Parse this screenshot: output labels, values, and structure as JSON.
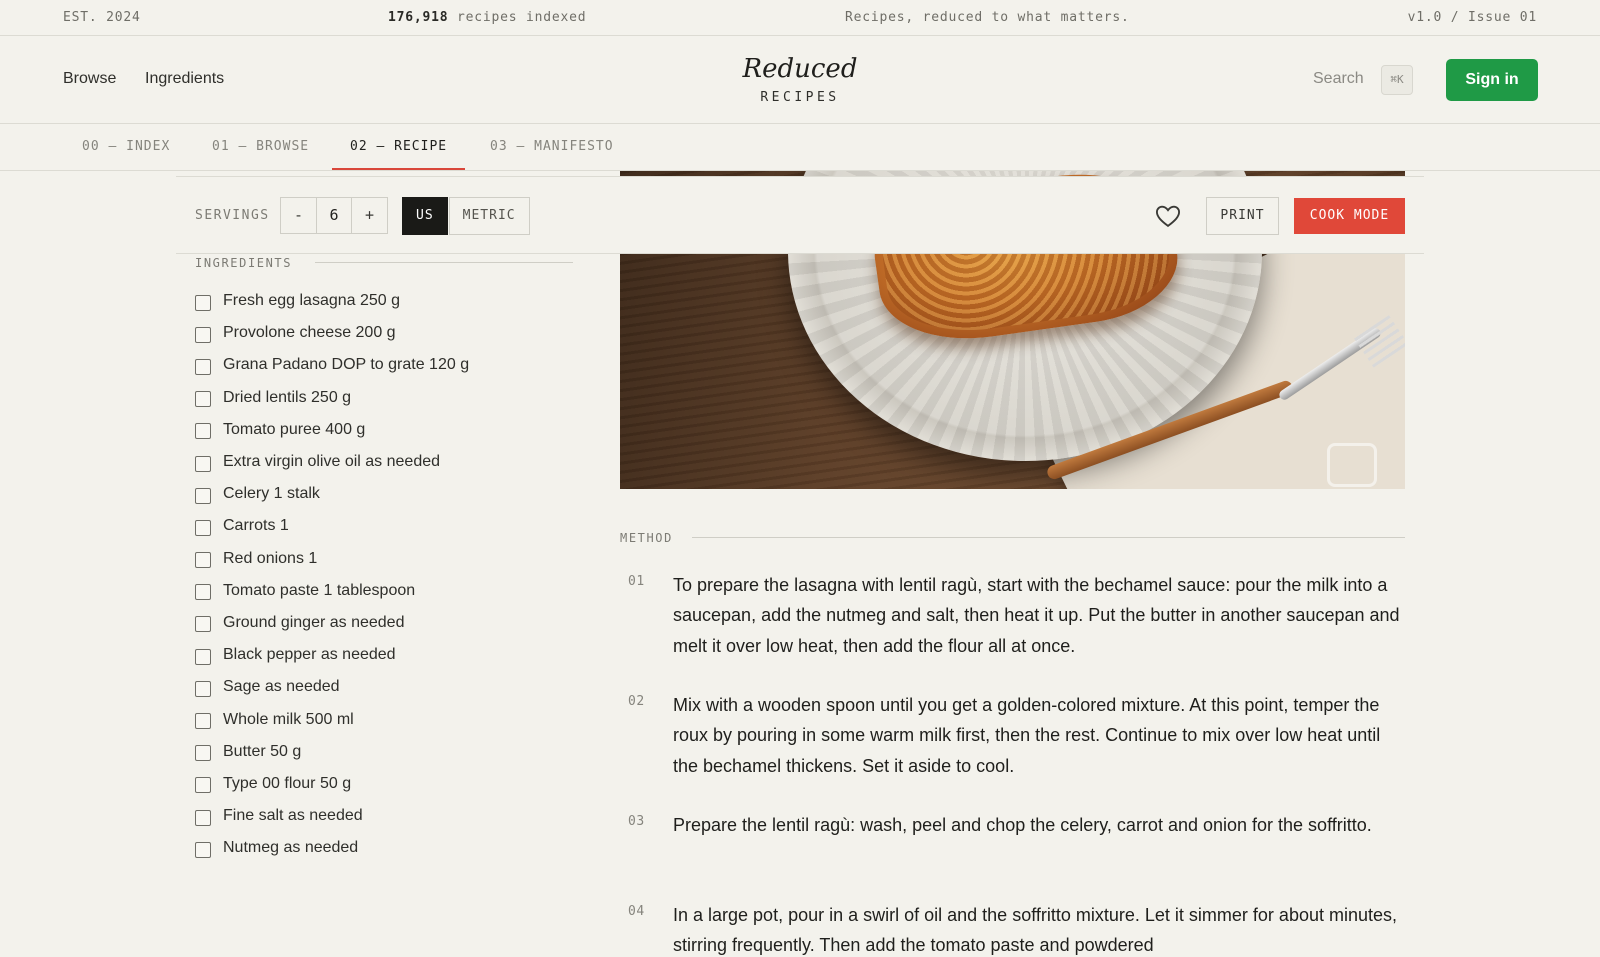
{
  "topbar": {
    "est": "EST. 2024",
    "recipe_count": "176,918",
    "recipe_count_suffix": " recipes indexed",
    "tagline": "Recipes, reduced to what matters.",
    "version": "v1.0 / Issue 01"
  },
  "header": {
    "nav": [
      "Browse",
      "Ingredients"
    ],
    "logo_word": "Reduced",
    "logo_sub": "RECIPES",
    "search_label": "Search",
    "search_shortcut": "⌘K",
    "signin_label": "Sign in"
  },
  "tabs": [
    "00 — INDEX",
    "01 — BROWSE",
    "02 — RECIPE",
    "03 — MANIFESTO"
  ],
  "active_tab": 2,
  "toolbar": {
    "servings_label": "SERVINGS",
    "decrement": "-",
    "servings_value": "6",
    "increment": "+",
    "units": [
      "US",
      "METRIC"
    ],
    "active_unit": "US",
    "print_label": "PRINT",
    "cook_mode_label": "COOK MODE"
  },
  "ingredients": {
    "title": "INGREDIENTS",
    "items": [
      "Fresh egg lasagna 250 g",
      "Provolone cheese 200 g",
      "Grana Padano DOP to grate 120 g",
      "Dried lentils 250 g",
      "Tomato puree 400 g",
      "Extra virgin olive oil as needed",
      "Celery 1 stalk",
      "Carrots 1",
      "Red onions 1",
      "Tomato paste 1 tablespoon",
      "Ground ginger as needed",
      "Black pepper as needed",
      "Sage as needed",
      "Whole milk 500 ml",
      "Butter 50 g",
      "Type 00 flour 50 g",
      "Fine salt as needed",
      "Nutmeg as needed"
    ]
  },
  "method": {
    "title": "METHOD",
    "steps": [
      {
        "num": "01",
        "text": "To prepare the lasagna with lentil ragù, start with the bechamel sauce: pour the milk into a saucepan, add the nutmeg and salt, then heat it up. Put the butter in another saucepan and melt it over low heat, then add the flour all at once."
      },
      {
        "num": "02",
        "text": "Mix with a wooden spoon until you get a golden-colored mixture. At this point, temper the roux by pouring in some warm milk first, then the rest. Continue to mix over low heat until the bechamel thickens. Set it aside to cool."
      },
      {
        "num": "03",
        "text": "Prepare the lentil ragù: wash, peel and chop the celery, carrot and onion for the soffritto."
      },
      {
        "num": "04",
        "text": "In a large pot, pour in a swirl of oil and the soffritto mixture. Let it simmer for about minutes, stirring frequently. Then add the tomato paste and powdered"
      }
    ]
  },
  "colors": {
    "background": "#f3f2ec",
    "accent_green": "#1f9a46",
    "accent_red": "#e04839",
    "active_tab_underline": "#d9473a"
  },
  "icons": [
    "heart-icon",
    "command-key-icon"
  ]
}
